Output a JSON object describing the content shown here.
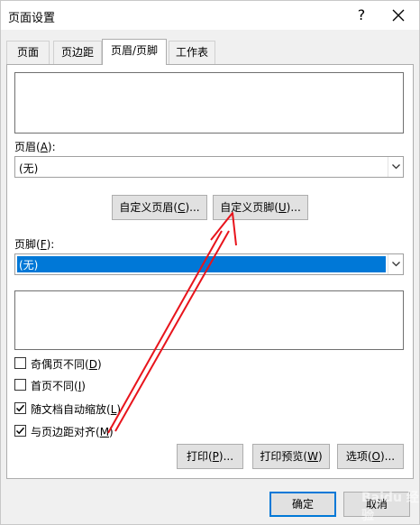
{
  "window": {
    "title": "页面设置",
    "help": "?",
    "close": "✕"
  },
  "tabs": [
    {
      "label": "页面"
    },
    {
      "label": "页边距"
    },
    {
      "label": "页眉/页脚"
    },
    {
      "label": "工作表"
    }
  ],
  "header": {
    "label_prefix": "页眉(",
    "label_key": "A",
    "label_suffix": "):",
    "selected": "(无)",
    "custom_button": {
      "text": "自定义页眉(",
      "key": "C",
      "suffix": ")..."
    }
  },
  "footer": {
    "label_prefix": "页脚(",
    "label_key": "F",
    "label_suffix": "):",
    "selected": "(无)",
    "custom_button": {
      "text": "自定义页脚(",
      "key": "U",
      "suffix": ")..."
    }
  },
  "options": [
    {
      "text": "奇偶页不同(",
      "key": "D",
      "suffix": ")",
      "checked": false
    },
    {
      "text": "首页不同(",
      "key": "I",
      "suffix": ")",
      "checked": false
    },
    {
      "text": "随文档自动缩放(",
      "key": "L",
      "suffix": ")",
      "checked": true
    },
    {
      "text": "与页边距对齐(",
      "key": "M",
      "suffix": ")",
      "checked": true
    }
  ],
  "actions": {
    "print": {
      "text": "打印(",
      "key": "P",
      "suffix": ")..."
    },
    "preview": {
      "text": "打印预览(",
      "key": "W",
      "suffix": ")"
    },
    "options": {
      "text": "选项(",
      "key": "O",
      "suffix": ")..."
    }
  },
  "footer_buttons": {
    "ok": "确定",
    "cancel": "取消"
  },
  "check_glyph": "✓",
  "dropdown_glyph": "⌄",
  "colors": {
    "accent": "#0078d7",
    "annotation": "#e8141c"
  },
  "watermark": "Baidu 经验"
}
